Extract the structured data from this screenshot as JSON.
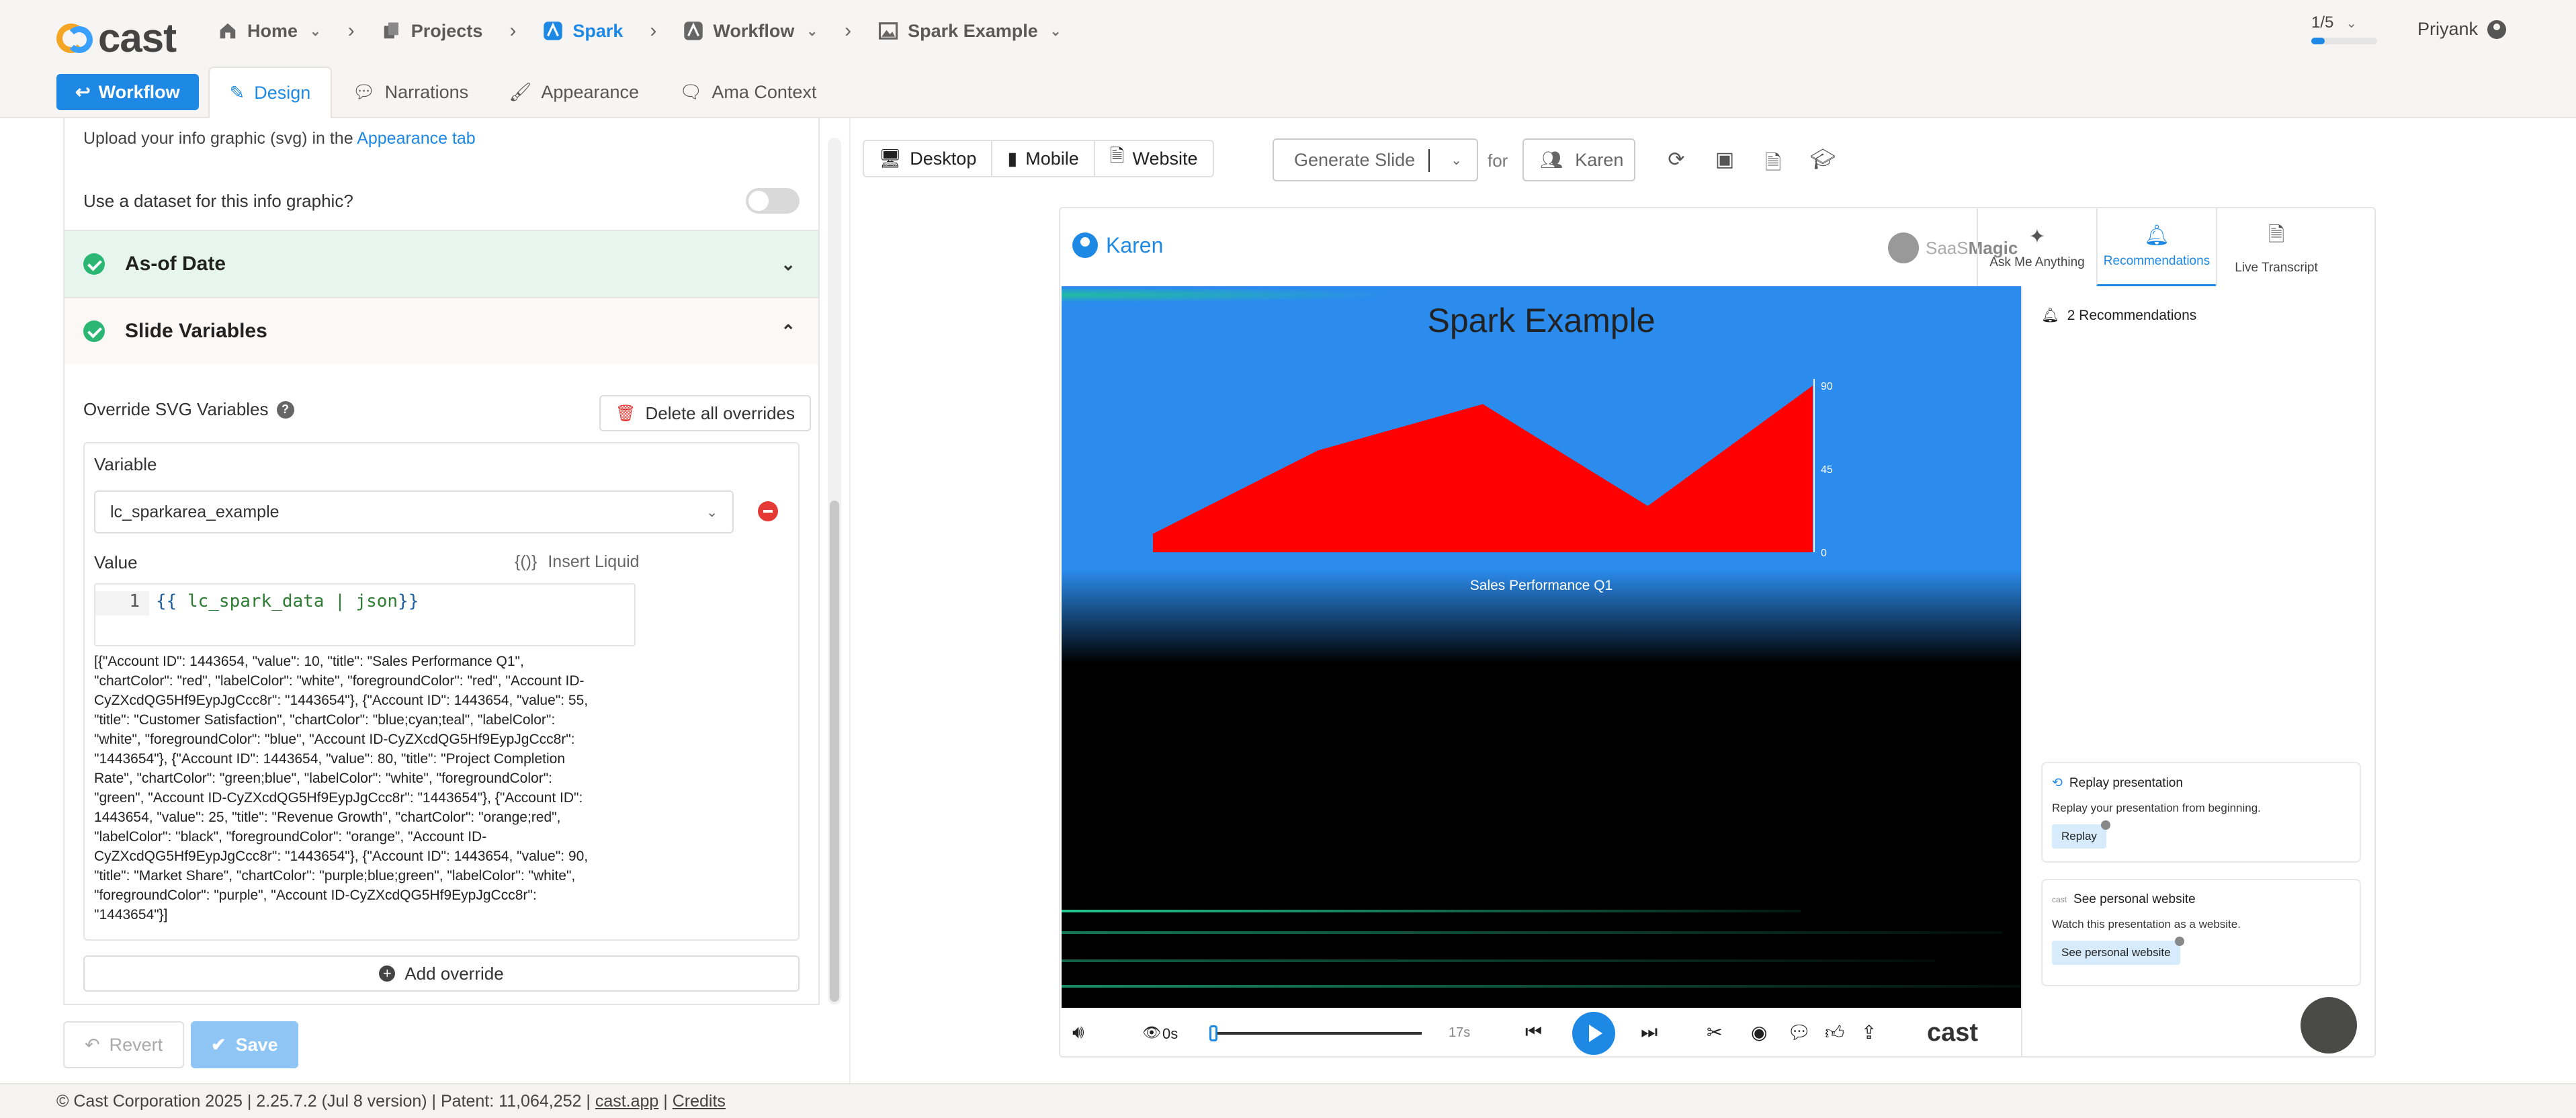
{
  "app": {
    "logo_text": "cast"
  },
  "breadcrumbs": [
    {
      "label": "Home",
      "icon": "home-icon"
    },
    {
      "label": "Projects",
      "icon": "projects-icon"
    },
    {
      "label": "Spark",
      "icon": "spark-icon"
    },
    {
      "label": "Workflow",
      "icon": "workflow-icon"
    },
    {
      "label": "Spark Example",
      "icon": "image-icon"
    }
  ],
  "pager": {
    "label": "1/5",
    "progress": 0.2
  },
  "user": {
    "name": "Priyank"
  },
  "tabs": {
    "workflow_button": "Workflow",
    "items": [
      "Design",
      "Narrations",
      "Appearance",
      "Ama Context"
    ]
  },
  "left": {
    "partial_text": "Upload your info graphic (svg) in the",
    "partial_link": "Appearance tab",
    "dataset_question": "Use a dataset for this info graphic?",
    "accordion_as_of": "As-of Date",
    "accordion_slide_vars": "Slide Variables",
    "override_label": "Override SVG Variables",
    "delete_all": "Delete all overrides",
    "variable_label": "Variable",
    "variable_value": "lc_sparkarea_example",
    "value_label": "Value",
    "insert_liquid": "Insert Liquid",
    "insert_liquid_icon": "{()}",
    "code_line_no": "1",
    "code_open": "{{",
    "code_var": " lc_spark_data | json",
    "code_close": "}}",
    "json_output": "[{\"Account ID\": 1443654, \"value\": 10, \"title\": \"Sales Performance Q1\", \"chartColor\": \"red\", \"labelColor\": \"white\", \"foregroundColor\": \"red\", \"Account ID-CyZXcdQG5Hf9EypJgCcc8r\": \"1443654\"}, {\"Account ID\": 1443654, \"value\": 55, \"title\": \"Customer Satisfaction\", \"chartColor\": \"blue;cyan;teal\", \"labelColor\": \"white\", \"foregroundColor\": \"blue\", \"Account ID-CyZXcdQG5Hf9EypJgCcc8r\": \"1443654\"}, {\"Account ID\": 1443654, \"value\": 80, \"title\": \"Project Completion Rate\", \"chartColor\": \"green;blue\", \"labelColor\": \"white\", \"foregroundColor\": \"green\", \"Account ID-CyZXcdQG5Hf9EypJgCcc8r\": \"1443654\"}, {\"Account ID\": 1443654, \"value\": 25, \"title\": \"Revenue Growth\", \"chartColor\": \"orange;red\", \"labelColor\": \"black\", \"foregroundColor\": \"orange\", \"Account ID-CyZXcdQG5Hf9EypJgCcc8r\": \"1443654\"}, {\"Account ID\": 1443654, \"value\": 90, \"title\": \"Market Share\", \"chartColor\": \"purple;blue;green\", \"labelColor\": \"white\", \"foregroundColor\": \"purple\", \"Account ID-CyZXcdQG5Hf9EypJgCcc8r\": \"1443654\"}]",
    "add_override": "Add override",
    "revert": "Revert",
    "save": "Save"
  },
  "preview": {
    "device_tabs": [
      "Desktop",
      "Mobile",
      "Website"
    ],
    "generate_label": "Generate Slide",
    "for_label": "for",
    "persona": "Karen",
    "player_user": "Karen",
    "brand_light": "SaaS",
    "brand_bold": "Magic",
    "side_tabs": [
      "Ask Me Anything",
      "Recommendations",
      "Live Transcript"
    ],
    "slide_title": "Spark Example",
    "chart_subtitle": "Sales Performance Q1",
    "recommendations_count": "2 Recommendations",
    "card1_title": "Replay presentation",
    "card1_desc": "Replay your presentation from beginning.",
    "card1_button": "Replay",
    "card2_title": "See personal website",
    "card2_logo": "cast",
    "card2_desc": "Watch this presentation as a website.",
    "card2_button": "See personal website",
    "time_current": "0s",
    "time_total": "17s",
    "player_logo": "cast"
  },
  "chart_data": {
    "type": "area",
    "x": [
      1,
      2,
      3,
      4,
      5
    ],
    "values": [
      10,
      55,
      80,
      25,
      90
    ],
    "color": "#ff0000",
    "yticks": [
      "0",
      "45",
      "90"
    ],
    "ylim": [
      0,
      90
    ],
    "xlabel": "Sales Performance Q1"
  },
  "footer": {
    "text": "© Cast Corporation 2025 | 2.25.7.2 (Jul 8 version) | Patent: 11,064,252 |",
    "link1": "cast.app",
    "link2": "Credits"
  }
}
